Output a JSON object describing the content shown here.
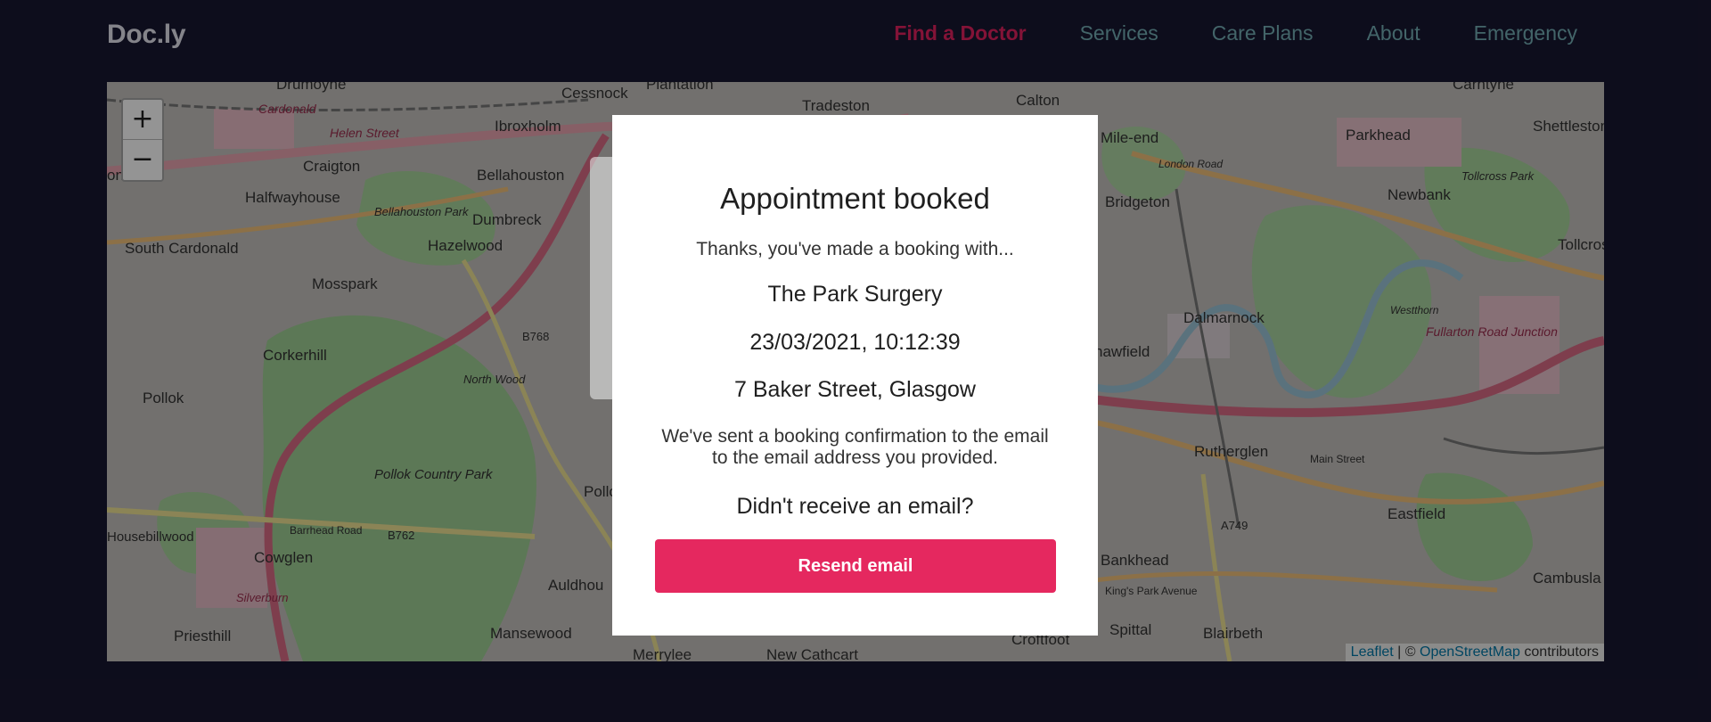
{
  "app": {
    "logo": "Doc.ly"
  },
  "nav": {
    "items": [
      {
        "label": "Find a Doctor",
        "active": true
      },
      {
        "label": "Services"
      },
      {
        "label": "Care Plans"
      },
      {
        "label": "About"
      },
      {
        "label": "Emergency"
      }
    ]
  },
  "map": {
    "zoom_in": "+",
    "zoom_out": "−",
    "attribution": {
      "leaflet": "Leaflet",
      "separator": " | © ",
      "osm": "OpenStreetMap",
      "suffix": " contributors"
    },
    "places": [
      "Drumoyne",
      "Cessnock",
      "Plantation",
      "Tradeston",
      "Calton",
      "Carntyne",
      "Cardonald",
      "Helen Street",
      "Ibroxholm",
      "Mile-end",
      "Parkhead",
      "Shettleston",
      "onald",
      "Craigton",
      "Bellahouston",
      "London Road",
      "Tollcross Park",
      "Halfwayhouse",
      "Bellahouston Park",
      "Dumbreck",
      "Bridgeton",
      "Newbank",
      "South Cardonald",
      "Hazelwood",
      "Tollcross",
      "Mosspark",
      "Dalmarnock",
      "B768",
      "Corkerhill",
      "North Wood",
      "hawfield",
      "Westthorn",
      "Fullarton Road Junction",
      "Pollok",
      "Pollok Country Park",
      "Pollokshi",
      "Rutherglen",
      "Main Street",
      "Eastfield",
      "Housebillwood",
      "Barrhead Road",
      "B762",
      "A749",
      "Cowglen",
      "Bankhead",
      "Auldhou",
      "Silverburn",
      "King's Park Avenue",
      "Cambusla",
      "Priesthill",
      "Mansewood",
      "Spittal",
      "Blairbeth",
      "Croftfoot",
      "Merrylee",
      "New Cathcart"
    ]
  },
  "modal": {
    "title": "Appointment booked",
    "intro": "Thanks, you've made a booking with...",
    "practice": "The Park Surgery",
    "datetime": "23/03/2021, 10:12:39",
    "address": "7 Baker Street, Glasgow",
    "email_note_line1": "We've sent a booking confirmation to the email",
    "email_note_line2": "to the email address you provided.",
    "resend_prompt": "Didn't receive an email?",
    "resend_button": "Resend email"
  },
  "colors": {
    "background": "#181731",
    "accent": "#e5285f",
    "nav_link": "#74aeb6"
  }
}
